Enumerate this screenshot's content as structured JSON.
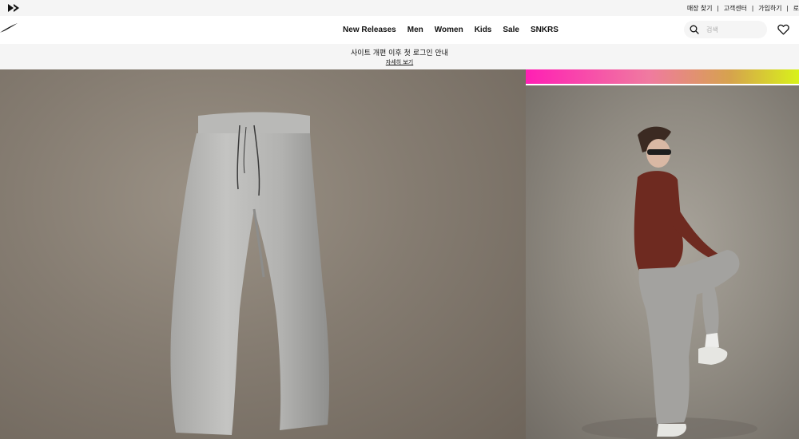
{
  "utility_bar": {
    "logo_icon": "converse-chevron-icon",
    "links": [
      "매장 찾기",
      "고객센터",
      "가입하기",
      "로"
    ]
  },
  "main_nav": {
    "logo_icon": "swoosh-icon",
    "items": [
      "New Releases",
      "Men",
      "Women",
      "Kids",
      "Sale",
      "SNKRS"
    ],
    "search": {
      "placeholder": "검색",
      "icon": "search-icon"
    },
    "favorites_icon": "heart-icon"
  },
  "banner": {
    "title": "사이트 개편 이후 첫 로그인 안내",
    "link": "자세히 보기"
  },
  "hero": {
    "left_image": "grey-sweatpants-product",
    "right_image": "model-in-grey-sweatpants-and-red-top",
    "gradient_colors": [
      "#ff1fb4",
      "#d8f21a"
    ]
  },
  "colors": {
    "utility_bg": "#f5f5f5",
    "text": "#111111",
    "hero_left_bg": "#857c71",
    "hero_right_bg": "#8f8a81"
  }
}
